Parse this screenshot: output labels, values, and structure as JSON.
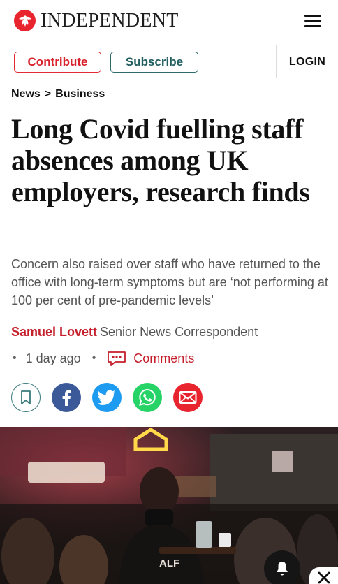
{
  "header": {
    "logo_text": "INDEPENDENT",
    "brand_color": "#e8242e"
  },
  "subbar": {
    "contribute_label": "Contribute",
    "subscribe_label": "Subscribe",
    "login_label": "LOGIN"
  },
  "breadcrumb": {
    "section": "News",
    "separator": ">",
    "subsection": "Business"
  },
  "article": {
    "headline": "Long Covid fuelling staff absences among UK employers, research finds",
    "standfirst": "Concern also raised over staff who have returned to the office with long-term symptoms but are ‘not performing at 100 per cent of pre-pandemic levels’",
    "author": "Samuel Lovett",
    "author_role": "Senior News Correspondent",
    "published": "1 day ago",
    "comments_label": "Comments"
  },
  "share": {
    "icons": [
      "bookmark-icon",
      "facebook-icon",
      "twitter-icon",
      "whatsapp-icon",
      "email-icon"
    ]
  },
  "colors": {
    "accent_red": "#c51f2c",
    "teal": "#2f6a6c",
    "facebook": "#3b5998",
    "twitter": "#1d9bf0",
    "whatsapp": "#25d366"
  }
}
